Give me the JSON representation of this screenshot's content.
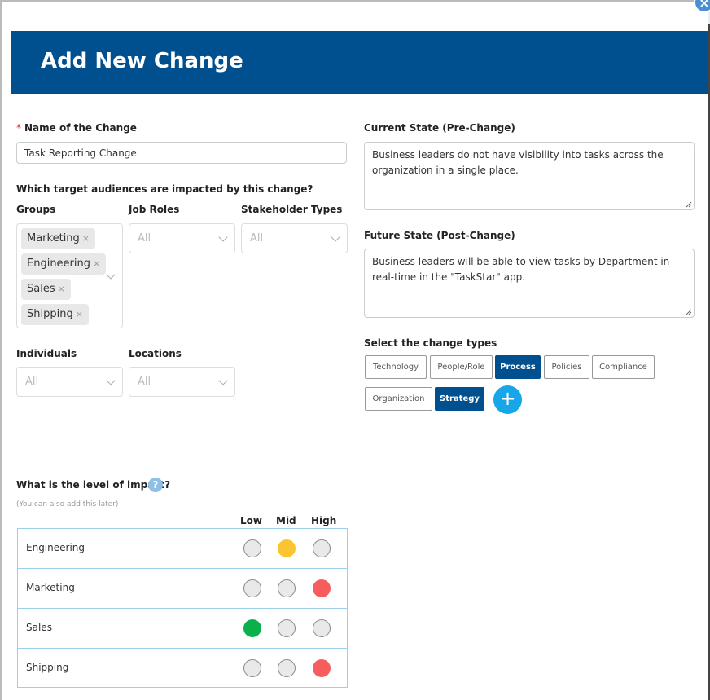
{
  "modal": {
    "title": "Add New Change",
    "close_glyph": "×"
  },
  "form": {
    "name_label": "Name of the Change",
    "name_required_mark": "*",
    "name_value": "Task Reporting Change",
    "audience_question": "Which target audiences are impacted by this change?",
    "groups_label": "Groups",
    "groups_tags": [
      "Marketing",
      "Engineering",
      "Sales",
      "Shipping"
    ],
    "tag_remove_glyph": "×",
    "job_roles_label": "Job Roles",
    "job_roles_value": "All",
    "stakeholder_types_label": "Stakeholder Types",
    "stakeholder_types_value": "All",
    "individuals_label": "Individuals",
    "individuals_value": "All",
    "locations_label": "Locations",
    "locations_value": "All",
    "current_state_label": "Current State (Pre-Change)",
    "current_state_value": "Business leaders do not have visibility into tasks across the organization in a single place.",
    "future_state_label": "Future State (Post-Change)",
    "future_state_value": "Business leaders will be able to view tasks by Department in real-time in the \"TaskStar\" app.",
    "change_types_label": "Select the change types",
    "change_types": [
      {
        "label": "Technology",
        "selected": false
      },
      {
        "label": "People/Role",
        "selected": false
      },
      {
        "label": "Process",
        "selected": true
      },
      {
        "label": "Policies",
        "selected": false
      },
      {
        "label": "Compliance",
        "selected": false
      },
      {
        "label": "Organization",
        "selected": false
      },
      {
        "label": "Strategy",
        "selected": true
      }
    ],
    "add_change_type_glyph": "+",
    "impact_question": "What is the level of impact?",
    "impact_help_glyph": "?",
    "impact_hint": "(You can also add this later)",
    "impact_columns": [
      "Low",
      "Mid",
      "High"
    ],
    "impact_rows": [
      {
        "name": "Engineering",
        "level": "Mid"
      },
      {
        "name": "Marketing",
        "level": "High"
      },
      {
        "name": "Sales",
        "level": "Low"
      },
      {
        "name": "Shipping",
        "level": "High"
      }
    ]
  },
  "colors": {
    "header": "#00508f",
    "accent": "#17a6e8",
    "low": "#0bb04a",
    "mid": "#fbc531",
    "high": "#f85d5d"
  }
}
